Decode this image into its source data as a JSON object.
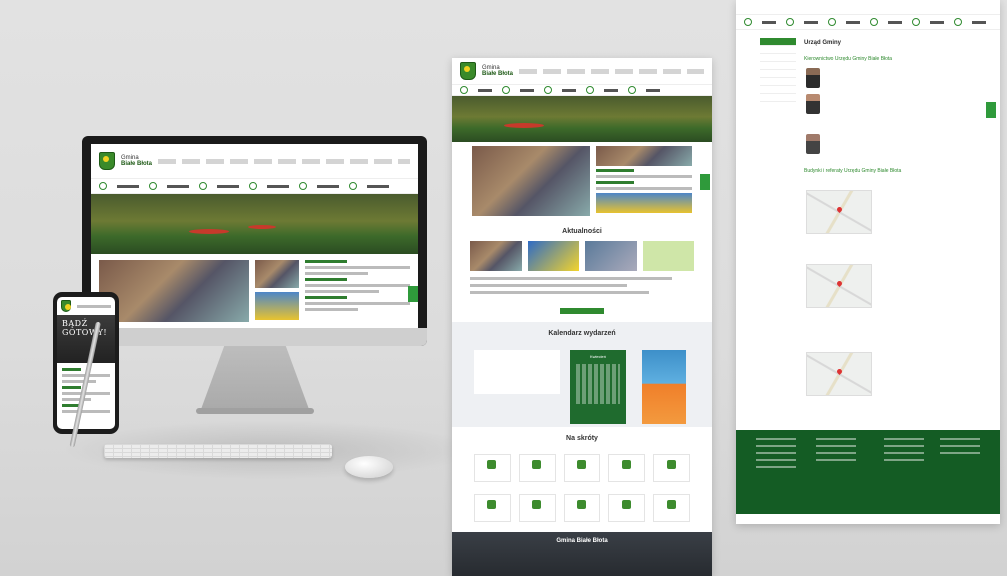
{
  "site": {
    "brand_line1": "Gmina",
    "brand_line2": "Białe Błota"
  },
  "phone": {
    "banner_line1": "BĄDŹ",
    "banner_line2": "GOTOWY!"
  },
  "middle_page": {
    "news_heading": "Aktualności",
    "calendar_heading": "Kalendarz wydarzeń",
    "calendar_month": "Kwiecień",
    "shortcuts_heading": "Na skróty",
    "footer_heading": "Gmina Białe Błota"
  },
  "right_page": {
    "page_heading": "Urząd Gminy",
    "section_management": "Kierownictwo Urzędu Gminy Białe Błota",
    "section_buildings": "Budynki i referaty Urzędu Gminy Białe Błota"
  },
  "colors": {
    "brand_green": "#2f8a2f",
    "footer_green": "#145c24",
    "background": "#dcdcdc"
  }
}
